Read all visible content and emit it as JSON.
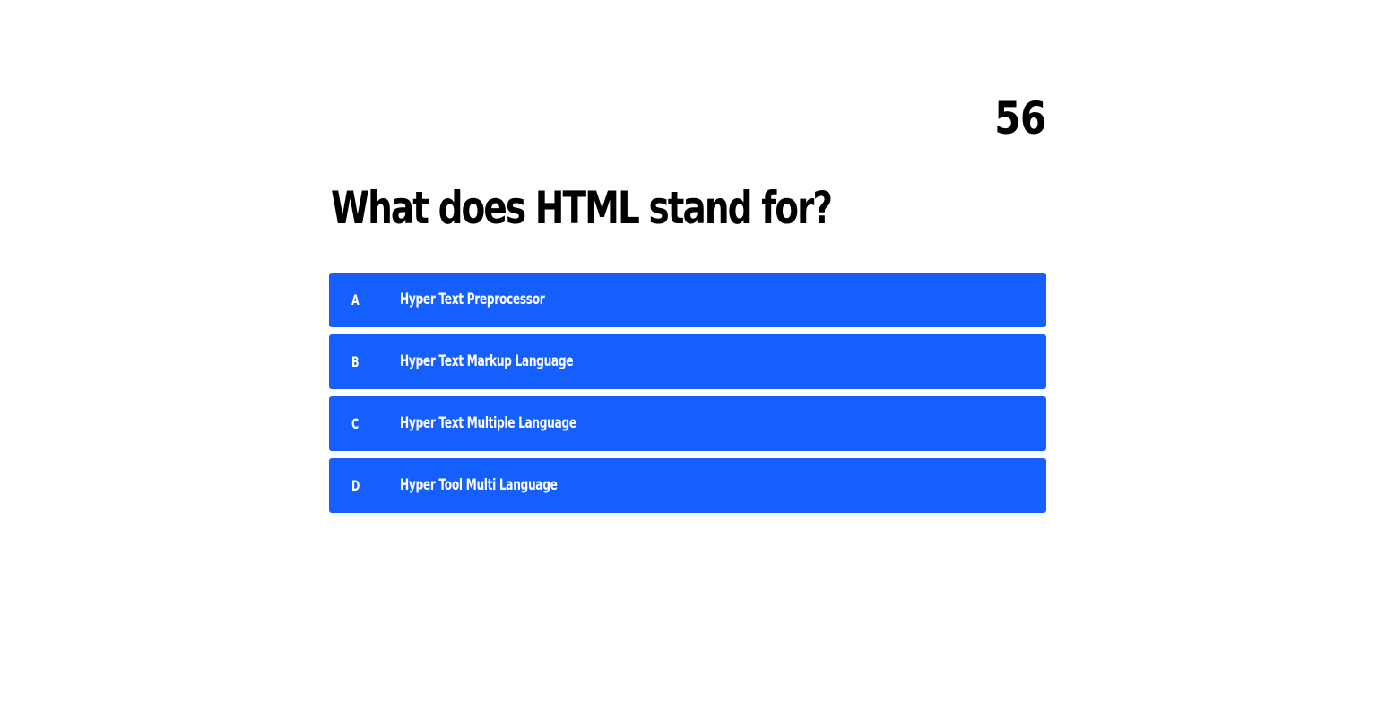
{
  "quiz": {
    "timer": "56",
    "question": "What does HTML stand for?",
    "options": [
      {
        "letter": "A",
        "text": "Hyper Text Preprocessor"
      },
      {
        "letter": "B",
        "text": "Hyper Text Markup Language"
      },
      {
        "letter": "C",
        "text": "Hyper Text Multiple Language"
      },
      {
        "letter": "D",
        "text": "Hyper Tool Multi Language"
      }
    ]
  },
  "colors": {
    "background": "#ffffff",
    "option_background": "#145ffe",
    "option_text": "#ffffff",
    "question_text": "#000000"
  }
}
